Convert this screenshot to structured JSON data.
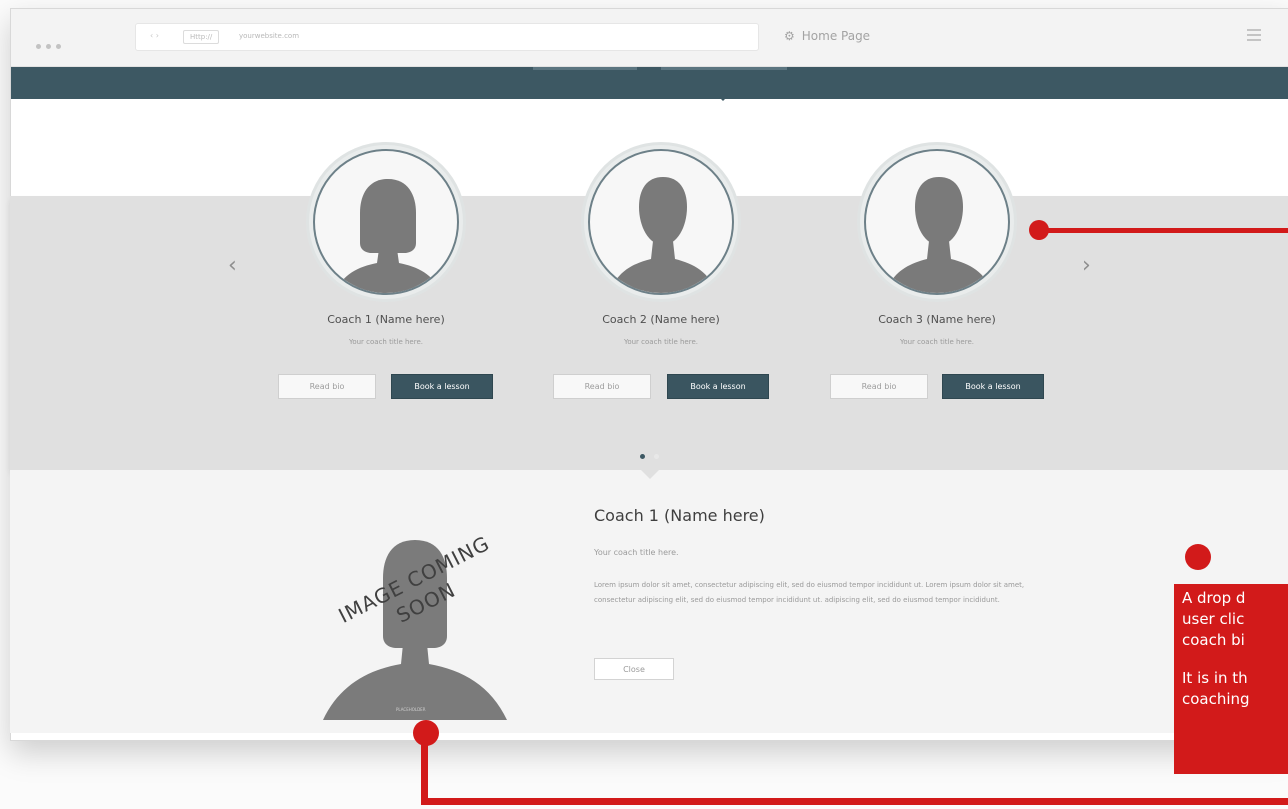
{
  "browser": {
    "nav_glyphs": "‹ ›",
    "address_badge": "Http://",
    "url": "yourwebsite.com",
    "page_title": "Home Page"
  },
  "carousel": {
    "coaches": [
      {
        "name": "Coach 1 (Name here)",
        "title": "Your coach title here.",
        "read_bio": "Read bio",
        "book": "Book a lesson",
        "avatar": "female-silhouette"
      },
      {
        "name": "Coach 2 (Name here)",
        "title": "Your coach title here.",
        "read_bio": "Read bio",
        "book": "Book a lesson",
        "avatar": "male-silhouette"
      },
      {
        "name": "Coach 3 (Name here)",
        "title": "Your coach title here.",
        "read_bio": "Read bio",
        "book": "Book a lesson",
        "avatar": "male-silhouette"
      }
    ],
    "prev_arrow": "‹",
    "next_arrow": "›",
    "active_page": 1,
    "page_count": 2
  },
  "detail": {
    "name": "Coach 1 (Name here)",
    "title": "Your coach title here.",
    "body": "Lorem ipsum dolor sit amet, consectetur adipiscing elit, sed do eiusmod tempor incididunt ut. Lorem ipsum dolor sit amet, consectetur adipiscing elit, sed do eiusmod tempor incididunt ut. adipiscing elit, sed do eiusmod tempor incididunt.",
    "close_label": "Close",
    "image_overlay_line1": "IMAGE COMING",
    "image_overlay_line2": "SOON",
    "image_caption": "PLACEHOLDER"
  },
  "annotation": {
    "line1": "A drop d",
    "line2": "user clic",
    "line3": "coach bi",
    "line4": "It is in th",
    "line5": "coaching"
  },
  "colors": {
    "navbar": "#3d5863",
    "book_button": "#3a5560",
    "annotation_red": "#d21a1a",
    "carousel_band": "#e0e0e0"
  }
}
